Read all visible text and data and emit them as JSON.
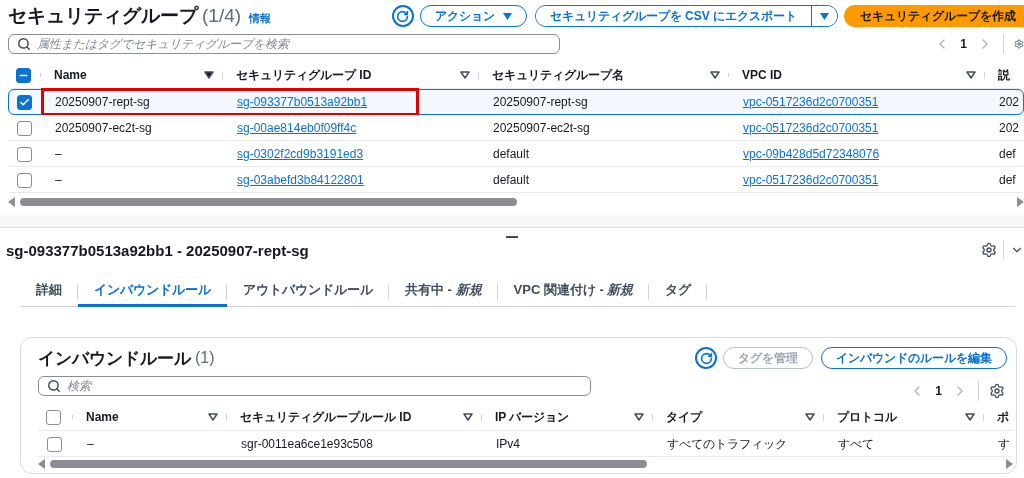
{
  "page": {
    "title": "セキュリティグループ",
    "count": "(1/4)",
    "info_link": "情報"
  },
  "toolbar": {
    "actions_button": "アクション",
    "export_button": "セキュリティグループを CSV にエクスポート",
    "create_button": "セキュリティグループを作成"
  },
  "search": {
    "placeholder": "属性またはタグでセキュリティグループを検索"
  },
  "pagination": {
    "page": "1"
  },
  "table": {
    "some_selected": true,
    "columns": [
      {
        "label": "Name",
        "sorted": true,
        "kind": "text"
      },
      {
        "label": "セキュリティグループ ID",
        "sorted": false,
        "kind": "link"
      },
      {
        "label": "セキュリティグループ名",
        "sorted": false,
        "kind": "text"
      },
      {
        "label": "VPC ID",
        "sorted": false,
        "kind": "link"
      },
      {
        "label": "説",
        "kind": "text"
      }
    ],
    "rows": [
      {
        "selected": true,
        "highlighted": true,
        "cells": [
          "20250907-rept-sg",
          "sg-093377b0513a92bb1",
          "20250907-rept-sg",
          "vpc-0517236d2c0700351",
          "202"
        ]
      },
      {
        "selected": false,
        "highlighted": false,
        "cells": [
          "20250907-ec2t-sg",
          "sg-00ae814eb0f09ff4c",
          "20250907-ec2t-sg",
          "vpc-0517236d2c0700351",
          "202"
        ]
      },
      {
        "selected": false,
        "highlighted": false,
        "cells": [
          "–",
          "sg-0302f2cd9b3191ed3",
          "default",
          "vpc-09b428d5d72348076",
          "def"
        ]
      },
      {
        "selected": false,
        "highlighted": false,
        "cells": [
          "–",
          "sg-03abefd3b84122801",
          "default",
          "vpc-0517236d2c0700351",
          "def"
        ]
      }
    ]
  },
  "detail": {
    "title": "sg-093377b0513a92bb1 - 20250907-rept-sg",
    "tabs": [
      {
        "label": "詳細",
        "selected": false
      },
      {
        "label": "インバウンドルール",
        "selected": true
      },
      {
        "label": "アウトバウンドルール",
        "selected": false
      },
      {
        "label": "共有中 - *新規*",
        "selected": false
      },
      {
        "label": "VPC 関連付け - *新規*",
        "selected": false
      },
      {
        "label": "タグ",
        "selected": false
      }
    ]
  },
  "inbound": {
    "title": "インバウンドルール",
    "count": "(1)",
    "manage_tags_button": {
      "label": "タグを管理",
      "disabled": true
    },
    "edit_button": "インバウンドのルールを編集",
    "search": {
      "placeholder": "検索"
    },
    "pagination": {
      "page": "1"
    },
    "table": {
      "all_selected": false,
      "some_selected": false,
      "columns": [
        {
          "label": "Name",
          "sorted": false
        },
        {
          "label": "セキュリティグループルール ID",
          "sorted": false
        },
        {
          "label": "IP バージョン",
          "sorted": false
        },
        {
          "label": "タイプ",
          "sorted": false
        },
        {
          "label": "プロトコル",
          "sorted": false
        },
        {
          "label": "ポ"
        }
      ],
      "rows": [
        {
          "selected": false,
          "highlighted": false,
          "cells": [
            "–",
            "sgr-0011ea6ce1e93c508",
            "IPv4",
            "すべてのトラフィック",
            "すべて",
            "す"
          ]
        }
      ]
    }
  }
}
